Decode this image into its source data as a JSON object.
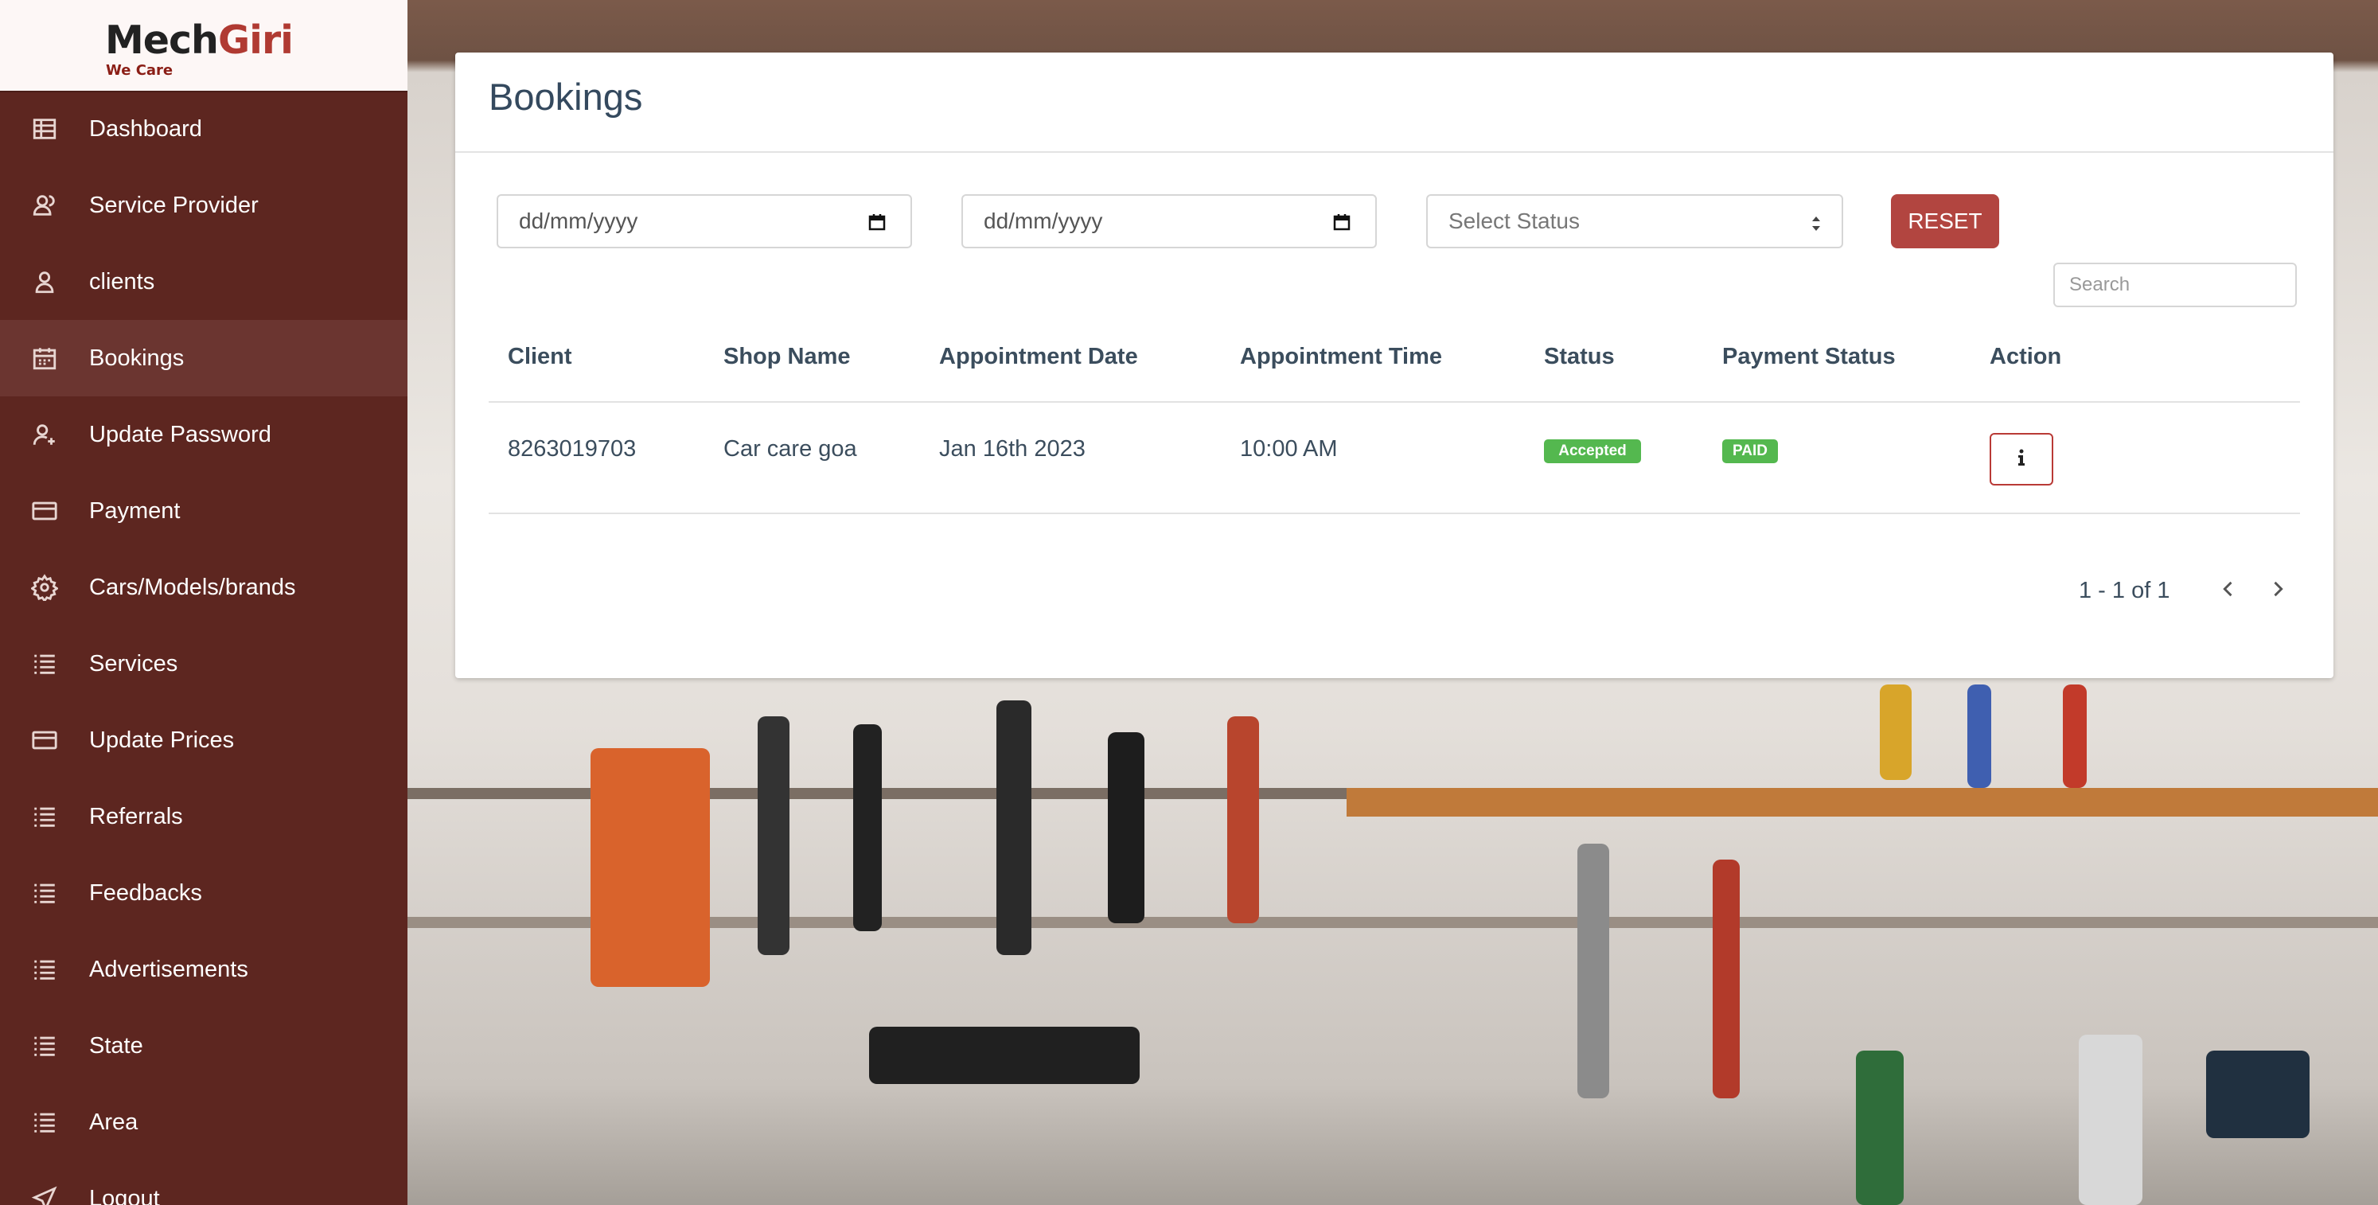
{
  "app": {
    "logo_main": "Mech",
    "logo_accent": "Giri",
    "logo_tagline": "We Care"
  },
  "sidebar": {
    "items": [
      {
        "label": "Dashboard",
        "icon": "table-icon"
      },
      {
        "label": "Service Provider",
        "icon": "users-icon"
      },
      {
        "label": "clients",
        "icon": "user-icon"
      },
      {
        "label": "Bookings",
        "icon": "calendar-icon",
        "active": true
      },
      {
        "label": "Update Password",
        "icon": "user-plus-icon"
      },
      {
        "label": "Payment",
        "icon": "credit-card-icon"
      },
      {
        "label": "Cars/Models/brands",
        "icon": "gear-icon"
      },
      {
        "label": "Services",
        "icon": "list-icon"
      },
      {
        "label": "Update Prices",
        "icon": "credit-card-icon"
      },
      {
        "label": "Referrals",
        "icon": "list-icon"
      },
      {
        "label": "Feedbacks",
        "icon": "list-icon"
      },
      {
        "label": "Advertisements",
        "icon": "list-icon"
      },
      {
        "label": "State",
        "icon": "list-icon"
      },
      {
        "label": "Area",
        "icon": "list-icon"
      },
      {
        "label": "Logout",
        "icon": "send-icon"
      }
    ]
  },
  "main": {
    "title": "Bookings",
    "filters": {
      "from_date_placeholder": "dd/mm/yyyy",
      "to_date_placeholder": "dd/mm/yyyy",
      "status_placeholder": "Select Status",
      "reset_label": "RESET",
      "search_placeholder": "Search"
    },
    "table": {
      "headers": [
        "Client",
        "Shop Name",
        "Appointment Date",
        "Appointment Time",
        "Status",
        "Payment Status",
        "Action"
      ],
      "rows": [
        {
          "client": "8263019703",
          "shop_name": "Car care goa",
          "date": "Jan 16th 2023",
          "time": "10:00 AM",
          "status": "Accepted",
          "payment_status": "PAID",
          "action_icon": "info-icon"
        }
      ]
    },
    "pagination": {
      "text": "1 - 1 of 1"
    }
  },
  "colors": {
    "sidebar_bg": "#5d2620",
    "accent": "#b03a32",
    "reset_button": "#b24540",
    "badge_green": "#54b84f"
  }
}
